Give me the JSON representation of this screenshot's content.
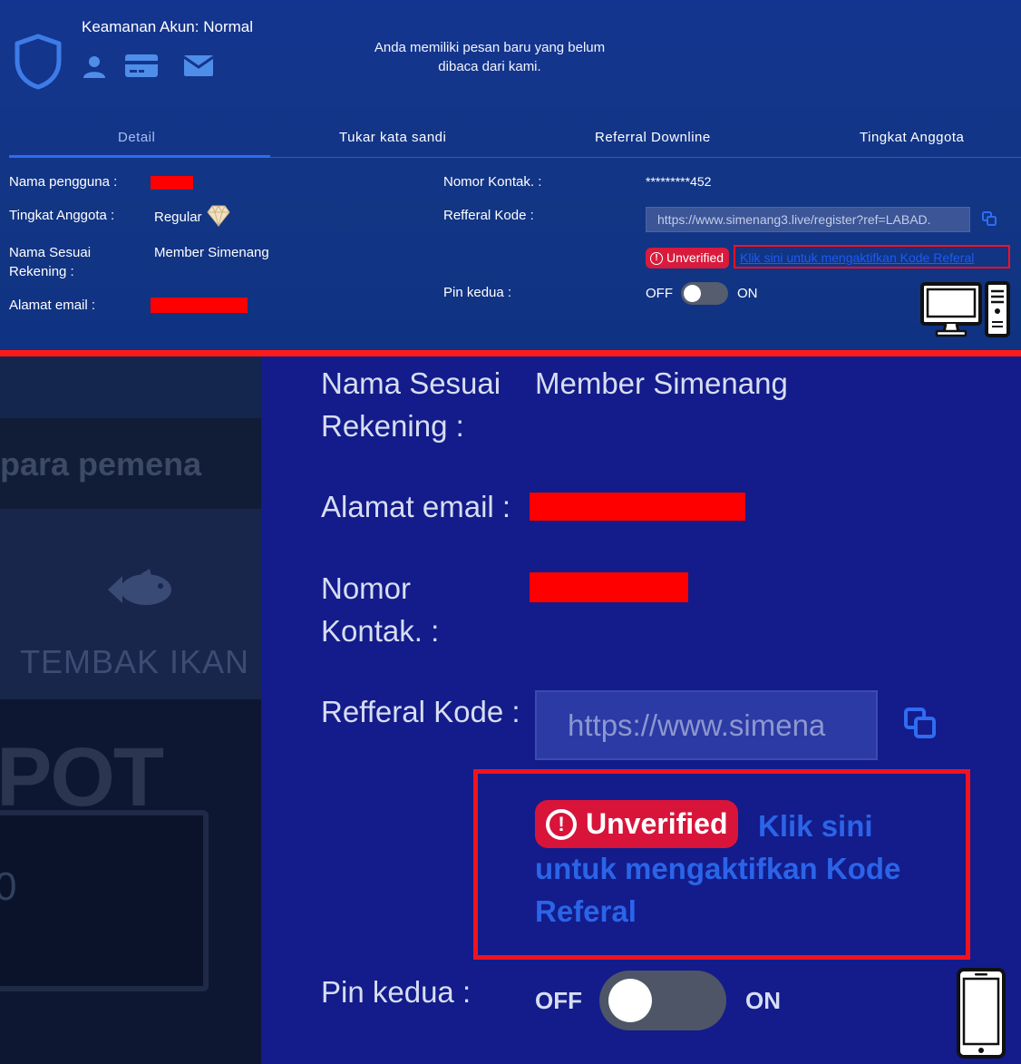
{
  "top": {
    "security_title": "Keamanan Akun: Normal",
    "notice": "Anda memiliki pesan baru yang belum dibaca dari kami.",
    "tabs": [
      {
        "label": "Detail",
        "active": true
      },
      {
        "label": "Tukar kata sandi",
        "active": false
      },
      {
        "label": "Referral Downline",
        "active": false
      },
      {
        "label": "Tingkat Anggota",
        "active": false
      }
    ],
    "fields": {
      "username_label": "Nama pengguna :",
      "member_level_label": "Tingkat Anggota :",
      "member_level_value": "Regular",
      "account_name_label": "Nama Sesuai Rekening :",
      "account_name_value": "Member Simenang",
      "email_label": "Alamat email :",
      "contact_label": "Nomor Kontak. :",
      "contact_value": "*********452",
      "referral_label": "Refferal Kode :",
      "referral_value": "https://www.simenang3.live/register?ref=LABAD.",
      "unverified": "Unverified",
      "activate_link": "Klik sini untuk mengaktifkan Kode Referal",
      "pin_label": "Pin kedua :",
      "toggle_off": "OFF",
      "toggle_on": "ON",
      "pin_enabled": false
    }
  },
  "mobile": {
    "background_text": {
      "winners": "para pemena",
      "fish_game": "TEMBAK IKAN",
      "jackpot": "POT",
      "counter": "0"
    },
    "account_name_label": "Nama Sesuai Rekening :",
    "account_name_value": "Member Simenang",
    "email_label": "Alamat email :",
    "contact_label": "Nomor Kontak. :",
    "referral_label": "Refferal Kode :",
    "referral_value": "https://www.simena",
    "unverified": "Unverified",
    "activate_link": "Klik sini untuk mengaktifkan Kode Referal",
    "pin_label": "Pin kedua :",
    "toggle_off": "OFF",
    "toggle_on": "ON",
    "pin_enabled": false
  },
  "colors": {
    "panel_blue": "#123584",
    "mobile_blue": "#131c8a",
    "redaction": "#ff0000",
    "highlight_box": "#f0131f",
    "badge_red": "#d8143a",
    "link_blue": "#2b64e8"
  },
  "icons": [
    "shield-icon",
    "user-icon",
    "credit-card-icon",
    "mail-icon",
    "diamond-icon",
    "copy-icon",
    "desktop-computer-icon",
    "smartphone-icon",
    "fish-icon"
  ]
}
